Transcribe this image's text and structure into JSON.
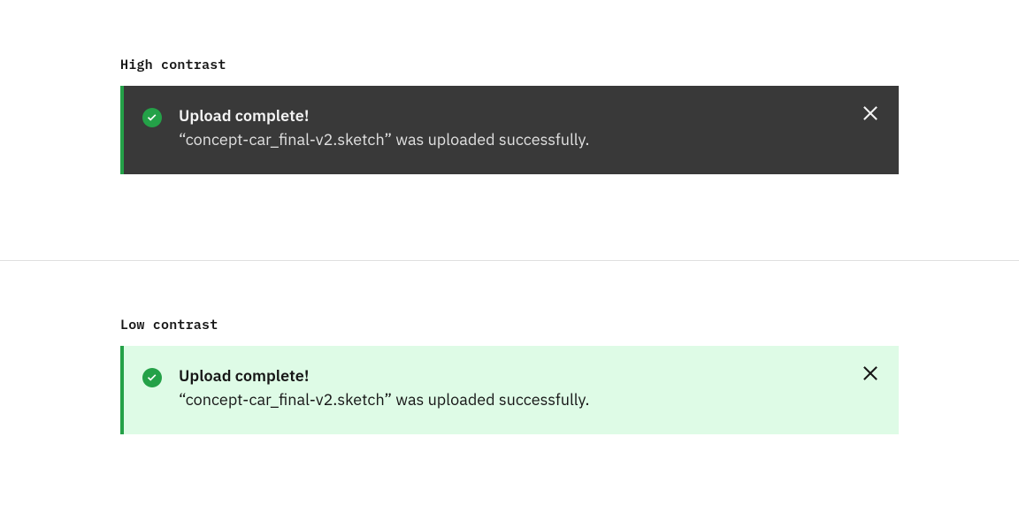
{
  "variants": {
    "high": {
      "label": "High contrast",
      "toast": {
        "title": "Upload complete!",
        "description": "“concept-car_final-v2.sketch” was uploaded successfully.",
        "accent_color": "#24a148",
        "background_color": "#393939",
        "icon": "checkmark-filled"
      }
    },
    "low": {
      "label": "Low contrast",
      "toast": {
        "title": "Upload complete!",
        "description": "“concept-car_final-v2.sketch” was uploaded successfully.",
        "accent_color": "#24a148",
        "background_color": "#defbe6",
        "icon": "checkmark-filled"
      }
    }
  }
}
